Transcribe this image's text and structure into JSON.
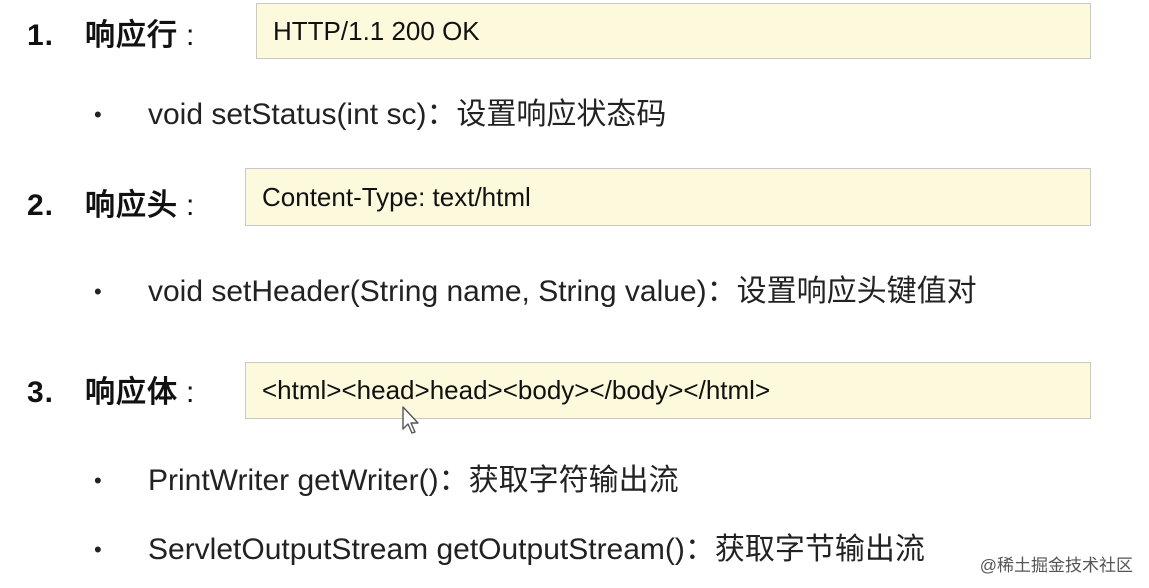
{
  "sections": [
    {
      "number": "1.",
      "title": "响应行",
      "colon": ":",
      "box_text": "HTTP/1.1 200 OK",
      "bullets": [
        "void setStatus(int sc)：设置响应状态码"
      ]
    },
    {
      "number": "2.",
      "title": "响应头",
      "colon": ":",
      "box_text": "Content-Type: text/html",
      "bullets": [
        "void setHeader(String name, String value)：设置响应头键值对"
      ]
    },
    {
      "number": "3.",
      "title": "响应体",
      "colon": ":",
      "box_text": "<html><head>head><body></body></html>",
      "bullets": [
        "PrintWriter getWriter()：获取字符输出流",
        "ServletOutputStream getOutputStream()：获取字节输出流"
      ]
    }
  ],
  "bullet_char": "•",
  "watermark": "@稀土掘金技术社区",
  "colors": {
    "box_background": "#fdf9dc",
    "box_border": "#c9c9c9",
    "text": "#1a1a1a"
  },
  "icons": {
    "cursor": "mouse-pointer-icon"
  }
}
